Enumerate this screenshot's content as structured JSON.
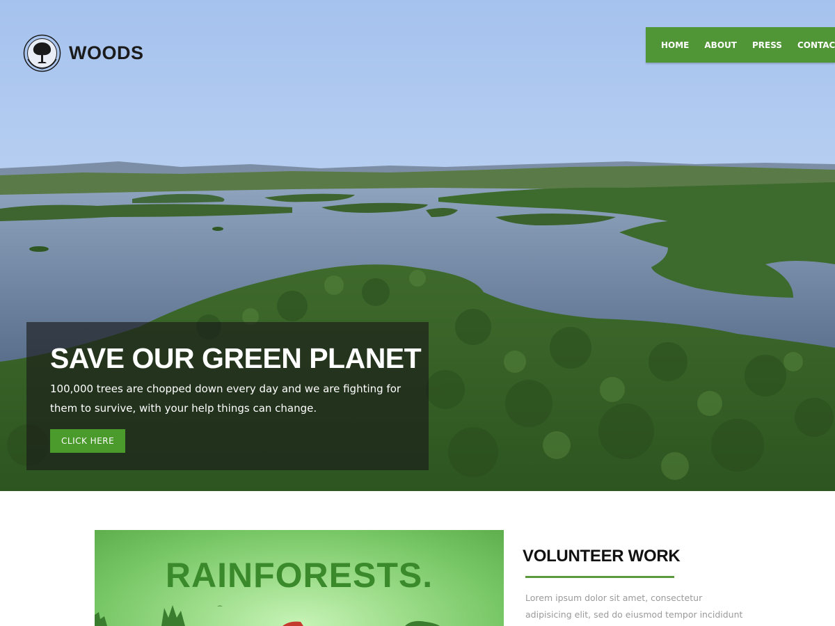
{
  "brand": {
    "name": "WOODS",
    "logo_icon": "tree-emblem-icon"
  },
  "nav": {
    "items": [
      {
        "label": "HOME"
      },
      {
        "label": "ABOUT"
      },
      {
        "label": "PRESS"
      },
      {
        "label": "CONTACT"
      }
    ]
  },
  "hero": {
    "title": "SAVE OUR GREEN PLANET",
    "text": "100,000 trees are chopped down every day and we are fighting for them to survive, with your help things can change.",
    "button_label": "CLICK HERE"
  },
  "feature": {
    "image_title": "RAINFORESTS."
  },
  "volunteer": {
    "title": "VOLUNTEER WORK",
    "text": "Lorem ipsum dolor sit amet, consectetur adipisicing elit, sed do eiusmod tempor incididunt ut labore et dolore"
  },
  "colors": {
    "accent_green": "#519636",
    "button_green": "#4a9a2c",
    "rule_green": "#5c9a3e",
    "overlay": "rgba(25,25,25,0.62)"
  }
}
